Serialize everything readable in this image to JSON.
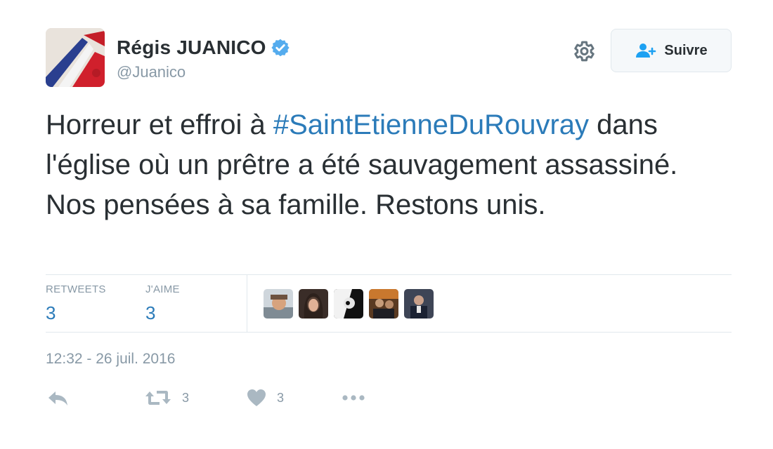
{
  "user": {
    "display_name": "Régis JUANICO",
    "handle": "@Juanico",
    "verified": true
  },
  "follow_button": {
    "label": "Suivre"
  },
  "tweet": {
    "text_before": "Horreur et effroi à ",
    "hashtag": "#SaintEtienneDuRouvray",
    "text_after": " dans l'église où un prêtre a été sauvagement assassiné. Nos pensées à sa famille. Restons unis."
  },
  "stats": {
    "retweets_label": "RETWEETS",
    "retweets_count": "3",
    "likes_label": "J'AIME",
    "likes_count": "3"
  },
  "timestamp": "12:32 - 26 juil. 2016",
  "actions": {
    "retweet_count": "3",
    "like_count": "3"
  },
  "colors": {
    "link": "#2b7bb9",
    "muted": "#8899a6",
    "verified": "#55acee",
    "text": "#292f33"
  },
  "icons": [
    "gear-icon",
    "follow-user-icon",
    "verified-badge-icon",
    "reply-icon",
    "retweet-icon",
    "heart-icon",
    "more-icon"
  ]
}
